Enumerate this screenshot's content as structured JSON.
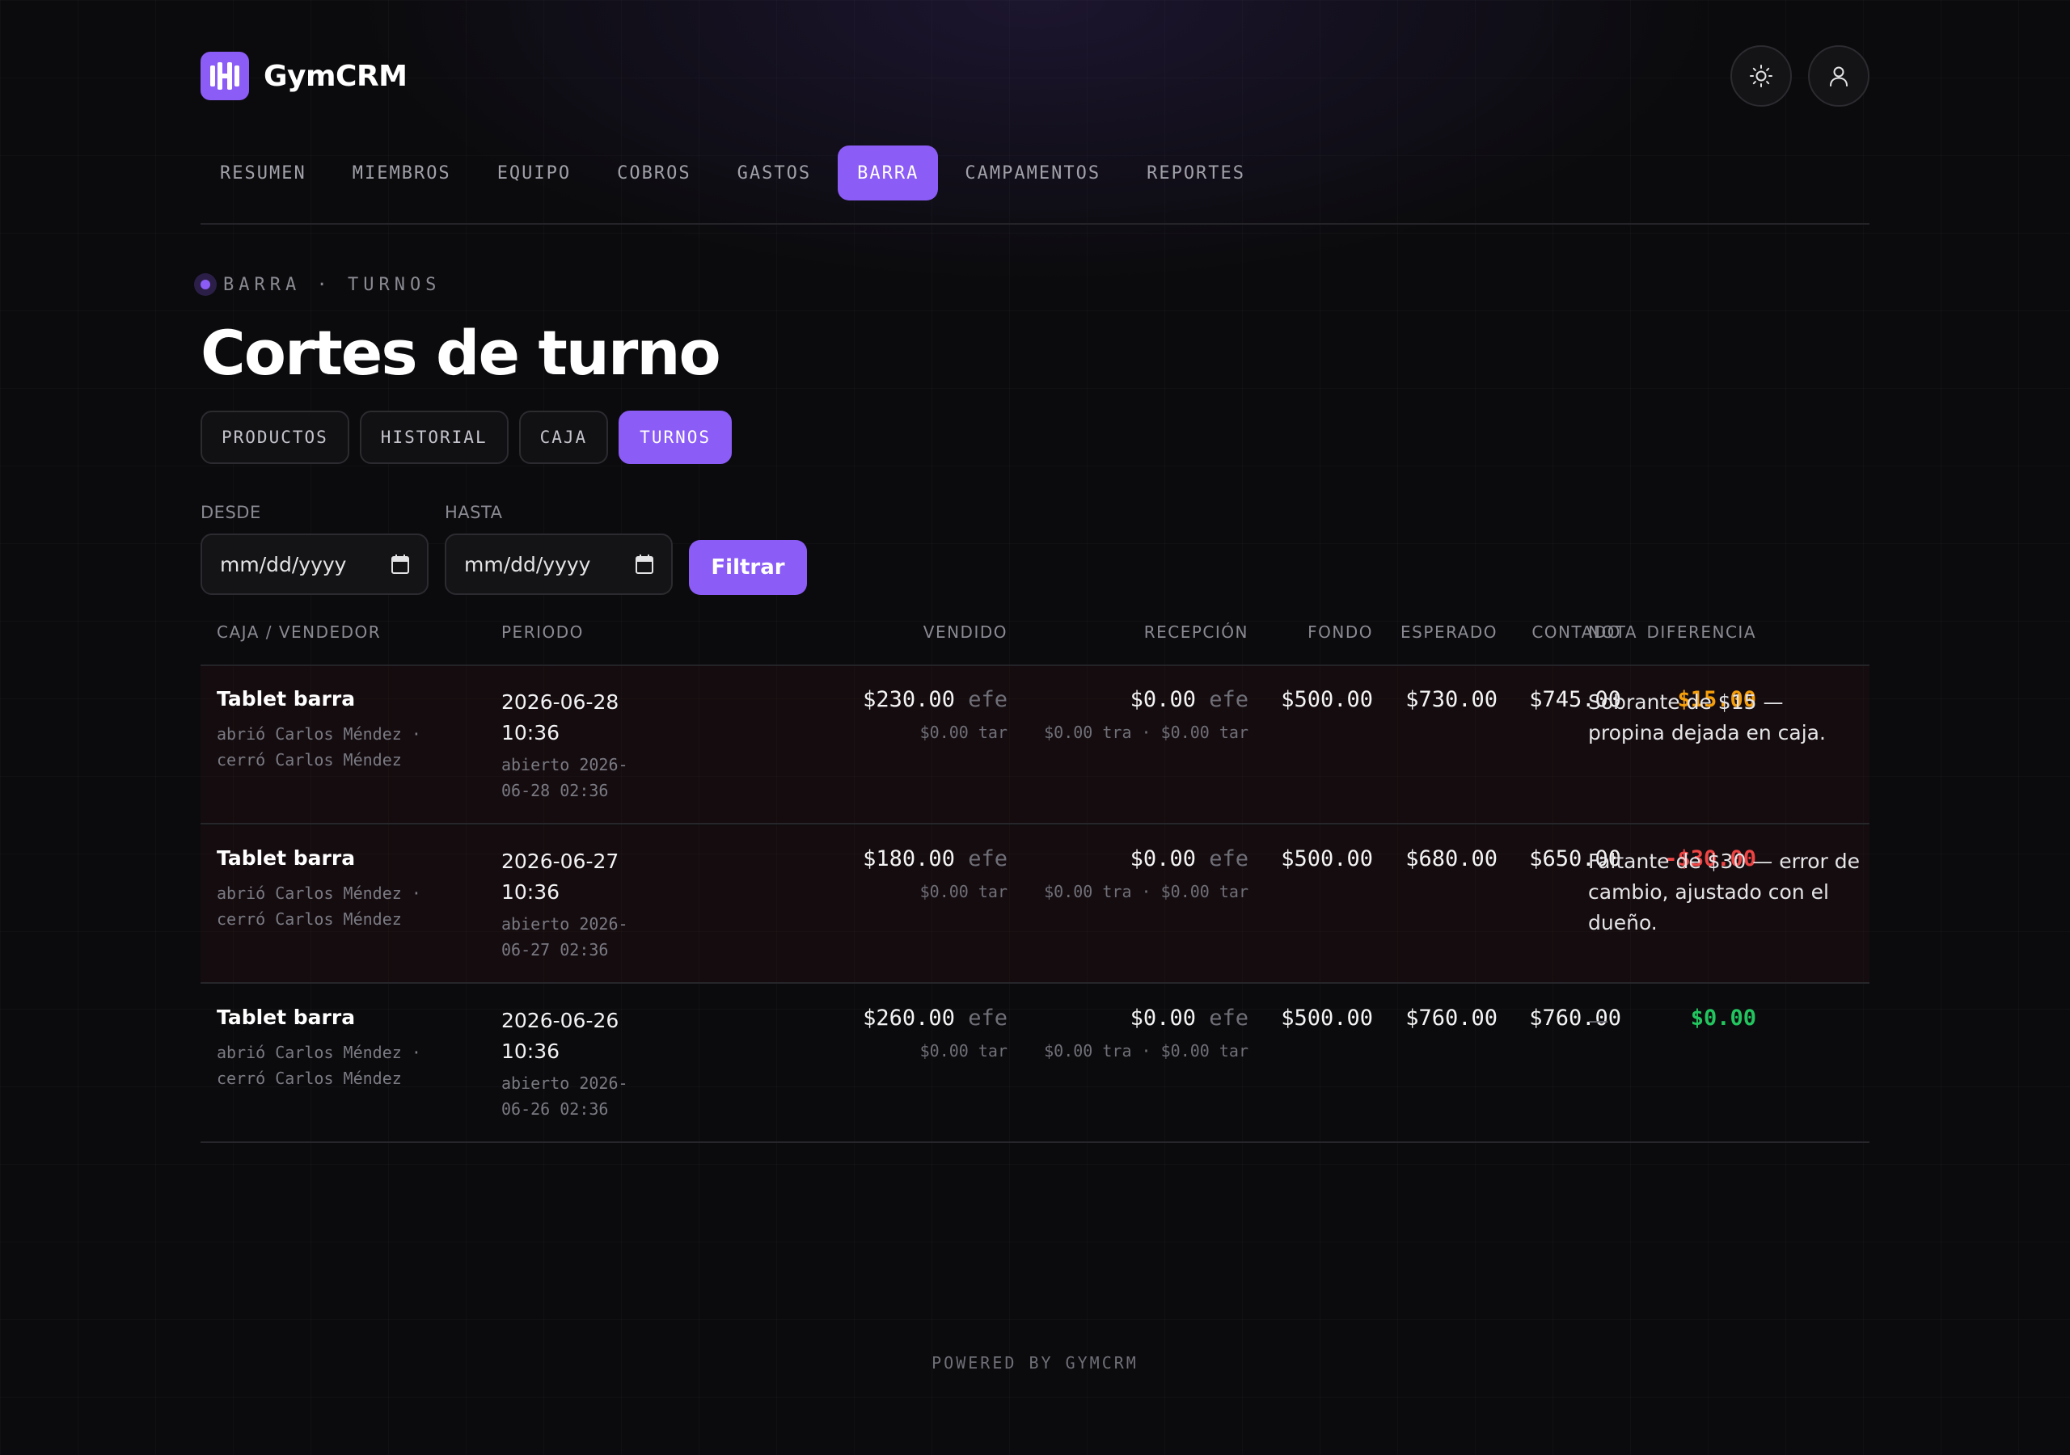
{
  "app": {
    "name": "GymCRM"
  },
  "colors": {
    "accent": "#8b5cf6",
    "surplus": "#f59e0b",
    "shortage": "#ef4444",
    "balanced": "#22c55e"
  },
  "header": {
    "theme_icon": "sun-icon",
    "user_icon": "user-icon"
  },
  "nav": [
    {
      "label": "RESUMEN",
      "active": false
    },
    {
      "label": "MIEMBROS",
      "active": false
    },
    {
      "label": "EQUIPO",
      "active": false
    },
    {
      "label": "COBROS",
      "active": false
    },
    {
      "label": "GASTOS",
      "active": false
    },
    {
      "label": "BARRA",
      "active": true
    },
    {
      "label": "CAMPAMENTOS",
      "active": false
    },
    {
      "label": "REPORTES",
      "active": false
    }
  ],
  "page": {
    "breadcrumb": "BARRA · TURNOS",
    "title": "Cortes de turno"
  },
  "subtabs": [
    {
      "label": "PRODUCTOS",
      "active": false
    },
    {
      "label": "HISTORIAL",
      "active": false
    },
    {
      "label": "CAJA",
      "active": false
    },
    {
      "label": "TURNOS",
      "active": true
    }
  ],
  "filters": {
    "from_label": "DESDE",
    "to_label": "HASTA",
    "from_value": "mm/dd/yyyy",
    "to_value": "mm/dd/yyyy",
    "filter_button": "Filtrar"
  },
  "table": {
    "columns": [
      "CAJA / VENDEDOR",
      "PERIODO",
      "VENDIDO",
      "RECEPCIÓN",
      "FONDO",
      "ESPERADO",
      "CONTADO",
      "DIFERENCIA",
      "NOTA"
    ],
    "rows": [
      {
        "register": "Tablet barra",
        "opened_by": "abrió Carlos Méndez ·",
        "closed_by": "cerró Carlos Méndez",
        "date_line1": "2026-06-28",
        "date_line2": "10:36",
        "opened_line1": "abierto 2026-",
        "opened_line2": "06-28 02:36",
        "sold_cash": "$230.00",
        "sold_cash_unit": "efe",
        "sold_card": "$0.00 tar",
        "reception_cash": "$0.00",
        "reception_cash_unit": "efe",
        "reception_other": "$0.00 tra · $0.00 tar",
        "fund": "$500.00",
        "expected": "$730.00",
        "counted": "$745.00",
        "difference": "$15.00",
        "difference_status": "surplus",
        "note": "Sobrante de $15 — propina dejada en caja."
      },
      {
        "register": "Tablet barra",
        "opened_by": "abrió Carlos Méndez ·",
        "closed_by": "cerró Carlos Méndez",
        "date_line1": "2026-06-27",
        "date_line2": "10:36",
        "opened_line1": "abierto 2026-",
        "opened_line2": "06-27 02:36",
        "sold_cash": "$180.00",
        "sold_cash_unit": "efe",
        "sold_card": "$0.00 tar",
        "reception_cash": "$0.00",
        "reception_cash_unit": "efe",
        "reception_other": "$0.00 tra · $0.00 tar",
        "fund": "$500.00",
        "expected": "$680.00",
        "counted": "$650.00",
        "difference": "-$30.00",
        "difference_status": "shortage",
        "note": "Faltante de $30 — error de cambio, ajustado con el dueño."
      },
      {
        "register": "Tablet barra",
        "opened_by": "abrió Carlos Méndez ·",
        "closed_by": "cerró Carlos Méndez",
        "date_line1": "2026-06-26",
        "date_line2": "10:36",
        "opened_line1": "abierto 2026-",
        "opened_line2": "06-26 02:36",
        "sold_cash": "$260.00",
        "sold_cash_unit": "efe",
        "sold_card": "$0.00 tar",
        "reception_cash": "$0.00",
        "reception_cash_unit": "efe",
        "reception_other": "$0.00 tra · $0.00 tar",
        "fund": "$500.00",
        "expected": "$760.00",
        "counted": "$760.00",
        "difference": "$0.00",
        "difference_status": "balanced",
        "note": "—"
      }
    ]
  },
  "footer": {
    "text": "POWERED BY GYMCRM"
  }
}
